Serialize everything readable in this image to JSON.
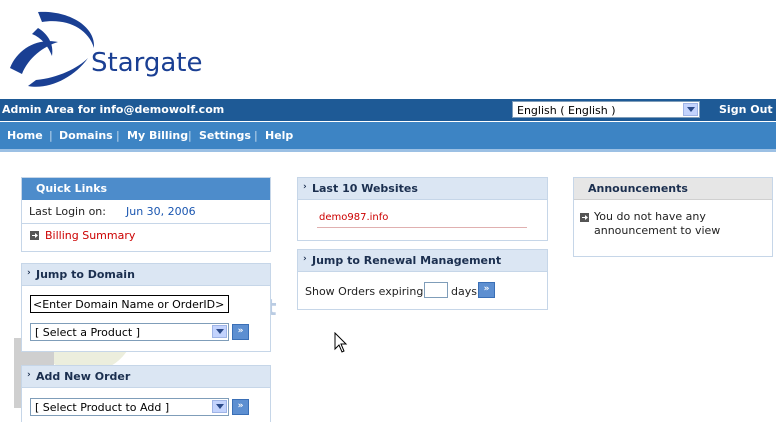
{
  "brand": {
    "name": "Stargate"
  },
  "topbar": {
    "admin_text": "Admin Area for info@demowolf.com",
    "language": "English ( English )",
    "sign_out": "Sign Out"
  },
  "nav": {
    "items": [
      "Home",
      "Domains",
      "My Billing",
      "Settings",
      "Help"
    ]
  },
  "quick_links": {
    "title": "Quick Links",
    "last_login_label": "Last Login on:",
    "last_login_date": "Jun 30, 2006",
    "billing_summary": "Billing Summary"
  },
  "jump_domain": {
    "title": "Jump to Domain",
    "input_value": "<Enter Domain Name or OrderID>",
    "product_select": "[ Select a Product ]"
  },
  "add_order": {
    "title": "Add New Order",
    "product_select": "[ Select Product to Add ]"
  },
  "last_websites": {
    "title": "Last 10 Websites",
    "items": [
      "demo987.info"
    ]
  },
  "renewal": {
    "title": "Jump to Renewal Management",
    "label_before": "Show Orders expiring in",
    "label_after": "days"
  },
  "announcements": {
    "title": "Announcements",
    "message": "You do not have any announcement to view"
  },
  "go_label": "»",
  "watermark_text": "FlipperHost",
  "colors": {
    "topbar": "#1e5a96",
    "navbar": "#3d84c4",
    "link_red": "#cc0000",
    "link_blue": "#1a56b0"
  }
}
